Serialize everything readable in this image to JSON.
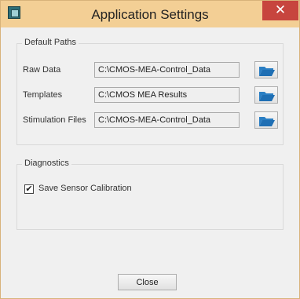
{
  "window": {
    "title": "Application Settings",
    "close_glyph": "✕"
  },
  "default_paths": {
    "group_title": "Default Paths",
    "rows": [
      {
        "label": "Raw Data",
        "value": "C:\\CMOS-MEA-Control_Data",
        "icon": "folder-open-icon"
      },
      {
        "label": "Templates",
        "value": "C:\\CMOS MEA Results",
        "icon": "folder-open-icon"
      },
      {
        "label": "Stimulation Files",
        "value": "C:\\CMOS-MEA-Control_Data",
        "icon": "folder-open-icon"
      }
    ]
  },
  "diagnostics": {
    "group_title": "Diagnostics",
    "save_sensor_calibration_label": "Save Sensor Calibration",
    "save_sensor_calibration_checked": true,
    "check_glyph": "✔"
  },
  "footer": {
    "close_label": "Close"
  },
  "colors": {
    "titlebar": "#f3cf95",
    "close_button": "#c7453e",
    "folder_icon": "#1f6fb4"
  }
}
